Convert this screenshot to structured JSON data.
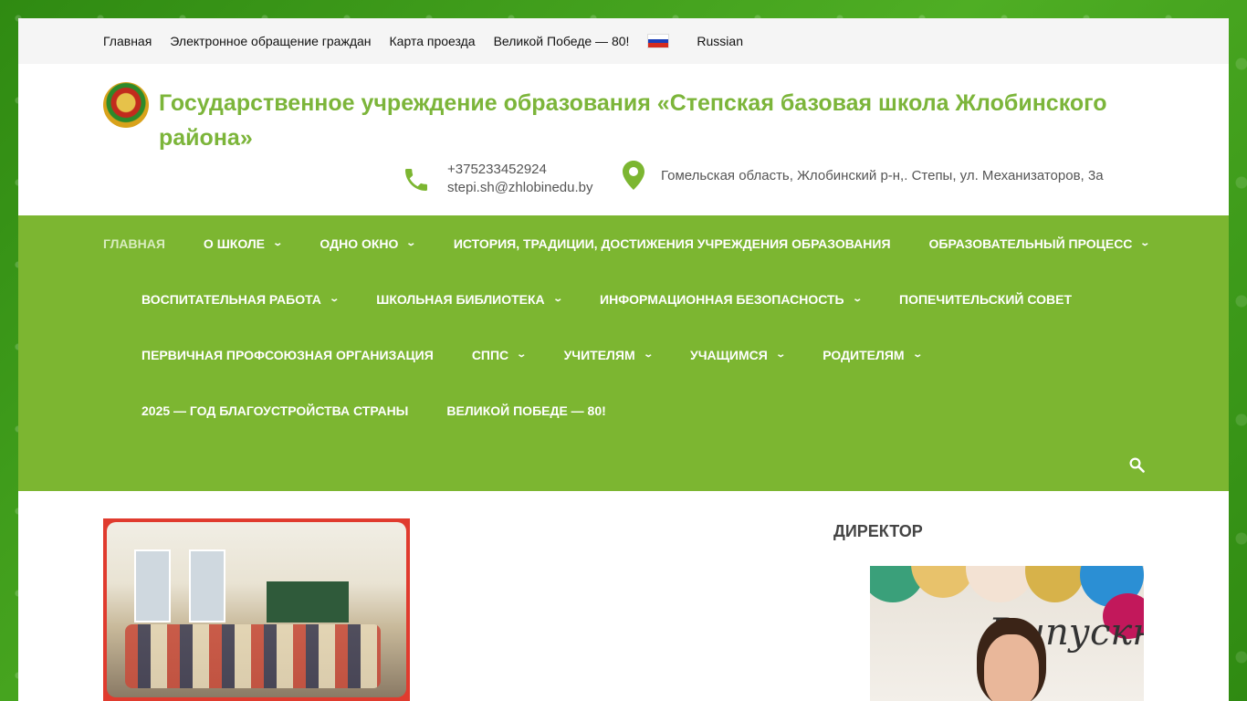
{
  "topbar": {
    "links": [
      "Главная",
      "Электронное обращение граждан",
      "Карта проезда",
      "Великой Победе — 80!"
    ],
    "language": "Russian"
  },
  "header": {
    "title": "Государственное учреждение образования «Степская базовая школа Жлобинского района»",
    "phone": "+375233452924",
    "email": "stepi.sh@zhlobinedu.by",
    "address": "Гомельская область, Жлобинский р-н,. Степы, ул. Механизаторов, 3а"
  },
  "nav": {
    "row1": [
      "Главная",
      "О школе",
      "Одно окно",
      "История, традиции, достижения учреждения образования",
      "Образовательный процесс"
    ],
    "row2": [
      "Воспитательная работа",
      "Школьная библиотека",
      "Информационная безопасность",
      "Попечительский совет"
    ],
    "row3": [
      "Первичная профсоюзная организация",
      "СППС",
      "Учителям",
      "Учащимся",
      "Родителям"
    ],
    "row4": [
      "2025 — год благоустройства страны",
      "Великой Победе — 80!"
    ]
  },
  "sidebar": {
    "title": "ДИРЕКТОР",
    "photo_text": "Выпускн"
  },
  "colors": {
    "accent": "#7cb631",
    "title": "#7cb53a"
  }
}
